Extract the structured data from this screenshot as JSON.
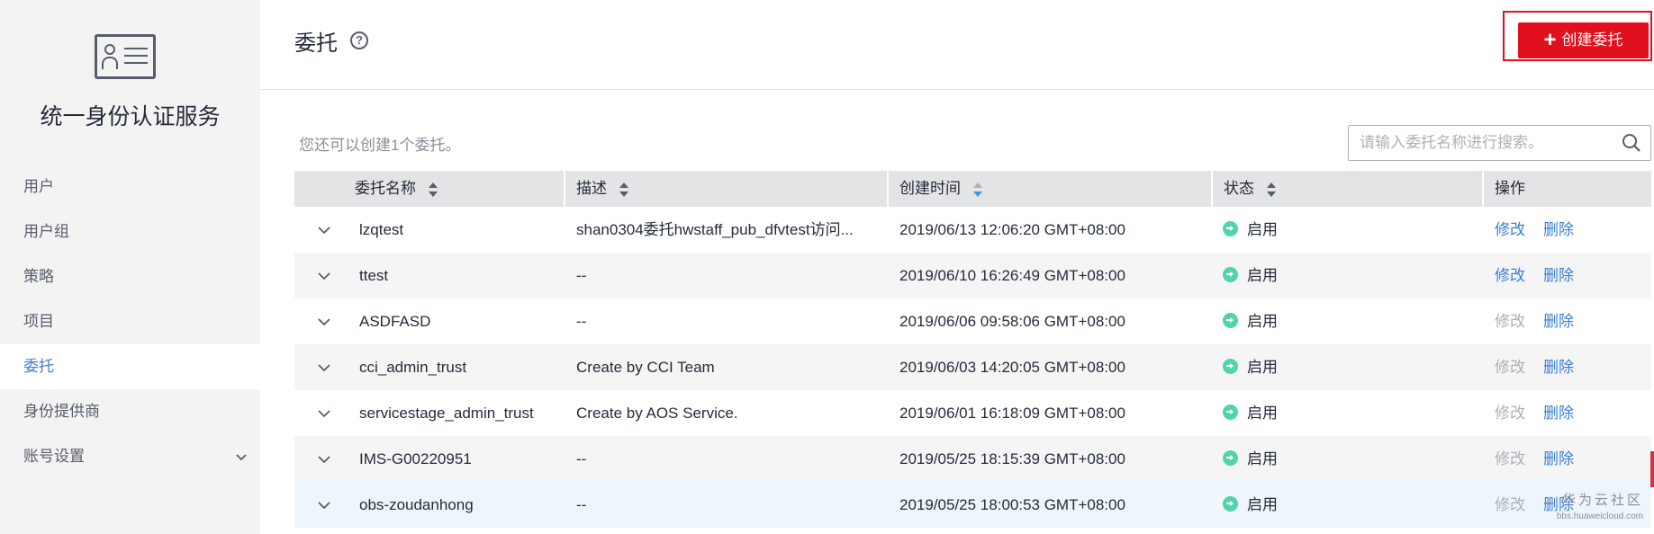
{
  "sidebar": {
    "title": "统一身份认证服务",
    "items": [
      {
        "label": "用户"
      },
      {
        "label": "用户组"
      },
      {
        "label": "策略"
      },
      {
        "label": "项目"
      },
      {
        "label": "委托",
        "active": true
      },
      {
        "label": "身份提供商"
      },
      {
        "label": "账号设置",
        "has_submenu": true
      }
    ]
  },
  "header": {
    "title": "委托",
    "create_button": "创建委托"
  },
  "toolbar": {
    "hint": "您还可以创建1个委托。",
    "search_placeholder": "请输入委托名称进行搜索。"
  },
  "table": {
    "columns": [
      "委托名称",
      "描述",
      "创建时间",
      "状态",
      "操作"
    ],
    "rows": [
      {
        "name": "lzqtest",
        "desc": "shan0304委托hwstaff_pub_dfvtest访问...",
        "time": "2019/06/13 12:06:20 GMT+08:00",
        "status": "启用",
        "edit": "修改",
        "delete": "删除",
        "edit_enabled": true
      },
      {
        "name": "ttest",
        "desc": "--",
        "time": "2019/06/10 16:26:49 GMT+08:00",
        "status": "启用",
        "edit": "修改",
        "delete": "删除",
        "edit_enabled": true
      },
      {
        "name": "ASDFASD",
        "desc": "--",
        "time": "2019/06/06 09:58:06 GMT+08:00",
        "status": "启用",
        "edit": "修改",
        "delete": "删除",
        "edit_enabled": false
      },
      {
        "name": "cci_admin_trust",
        "desc": "Create by CCI Team",
        "time": "2019/06/03 14:20:05 GMT+08:00",
        "status": "启用",
        "edit": "修改",
        "delete": "删除",
        "edit_enabled": false
      },
      {
        "name": "servicestage_admin_trust",
        "desc": "Create by AOS Service.",
        "time": "2019/06/01 16:18:09 GMT+08:00",
        "status": "启用",
        "edit": "修改",
        "delete": "删除",
        "edit_enabled": false
      },
      {
        "name": "IMS-G00220951",
        "desc": "--",
        "time": "2019/05/25 18:15:39 GMT+08:00",
        "status": "启用",
        "edit": "修改",
        "delete": "删除",
        "edit_enabled": false
      },
      {
        "name": "obs-zoudanhong",
        "desc": "--",
        "time": "2019/05/25 18:00:53 GMT+08:00",
        "status": "启用",
        "edit": "修改",
        "delete": "删除",
        "edit_enabled": false
      }
    ]
  },
  "watermark": {
    "text": "华为云社区",
    "url": "bbs.huaweicloud.com"
  },
  "colors": {
    "accent_red": "#e0101e",
    "link_blue": "#3b7fd5",
    "status_green": "#50d4ab"
  }
}
